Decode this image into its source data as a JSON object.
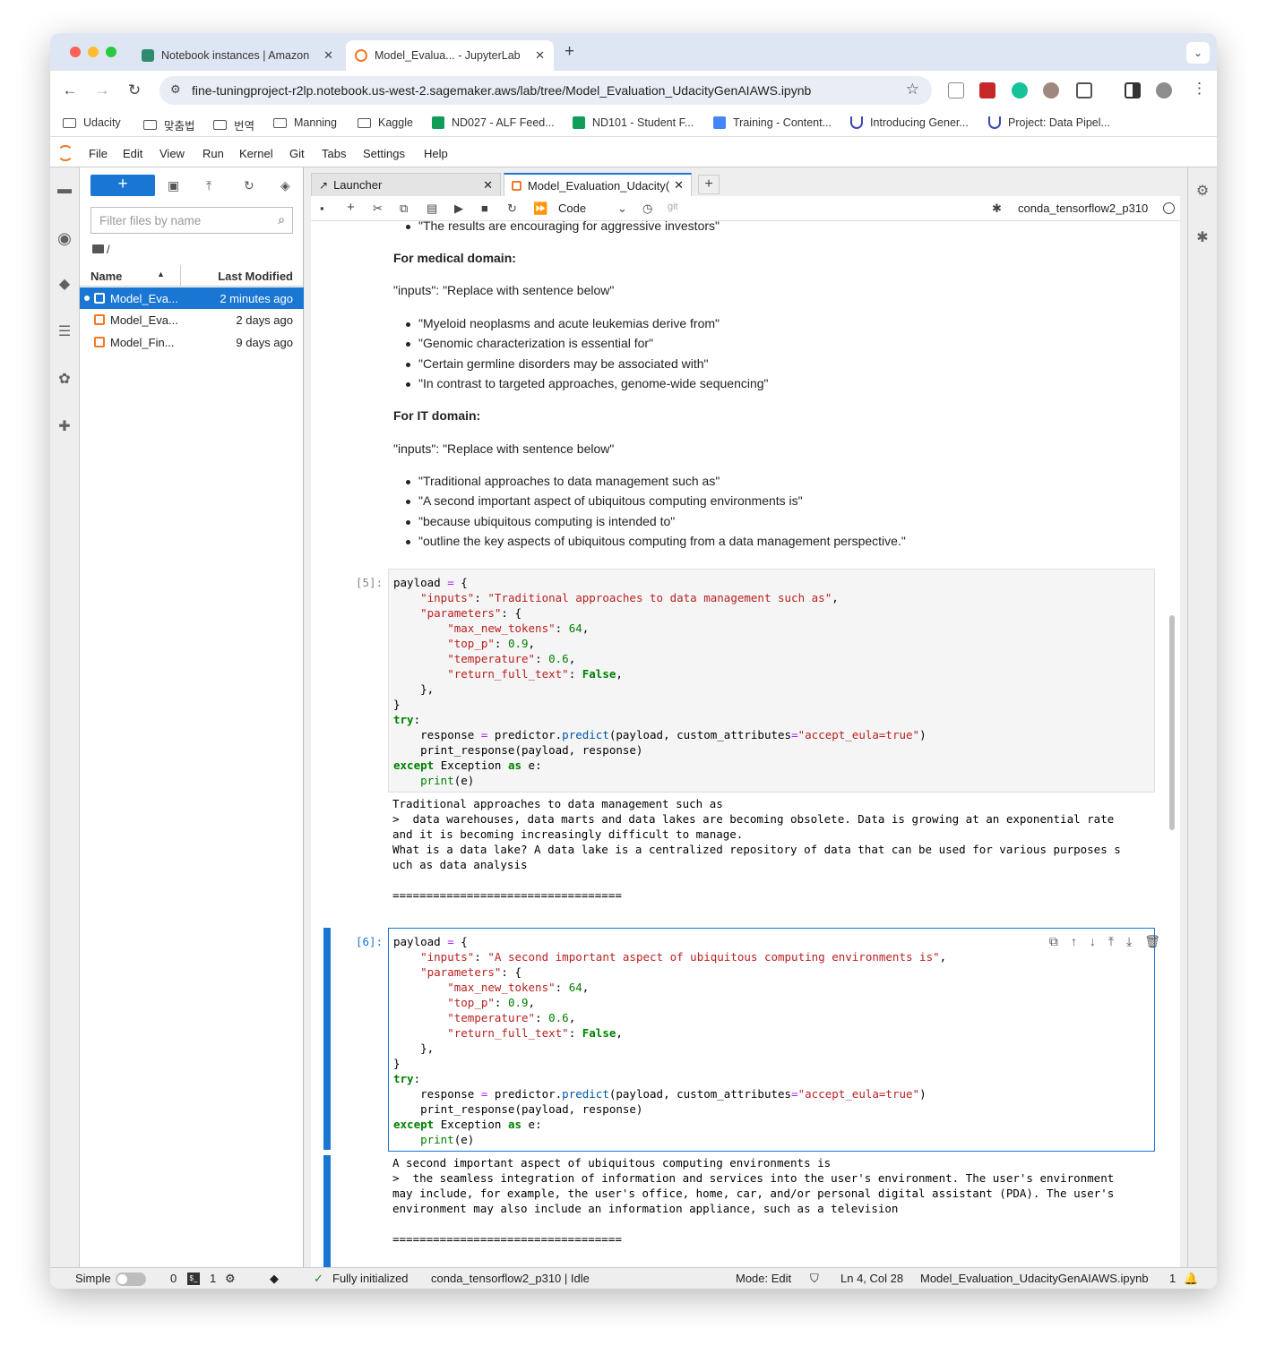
{
  "browser": {
    "tabs": [
      {
        "title": "Notebook instances | Amazon",
        "active": false
      },
      {
        "title": "Model_Evalua... - JupyterLab",
        "active": true
      }
    ],
    "new_tab": "+",
    "url": "fine-tuningproject-r2lp.notebook.us-west-2.sagemaker.aws/lab/tree/Model_Evaluation_UdacityGenAIAWS.ipynb",
    "bookmarks": [
      "Udacity",
      "맞춤법",
      "번역",
      "Manning",
      "Kaggle",
      "ND027 - ALF Feed...",
      "ND101 - Student F...",
      "Training - Content...",
      "Introducing Gener...",
      "Project: Data Pipel..."
    ]
  },
  "jupyter": {
    "menu": [
      "File",
      "Edit",
      "View",
      "Run",
      "Kernel",
      "Git",
      "Tabs",
      "Settings",
      "Help"
    ],
    "filebrowser": {
      "new_label": "+",
      "filter_placeholder": "Filter files by name",
      "breadcrumb": "/",
      "col_name": "Name",
      "col_modified": "Last Modified",
      "files": [
        {
          "name": "Model_Eva...",
          "modified": "2 minutes ago",
          "selected": true
        },
        {
          "name": "Model_Eva...",
          "modified": "2 days ago",
          "selected": false
        },
        {
          "name": "Model_Fin...",
          "modified": "9 days ago",
          "selected": false
        }
      ]
    },
    "doc_tabs": [
      {
        "title": "Launcher",
        "active": false
      },
      {
        "title": "Model_Evaluation_Udacity(",
        "active": true
      }
    ],
    "toolbar": {
      "cell_type": "Code",
      "git": "git",
      "kernel": "conda_tensorflow2_p310"
    },
    "markdown": {
      "top_bullet": "\"The results are encouraging for aggressive investors\"",
      "medical_heading": "For medical domain:",
      "medical_inputs": "\"inputs\": \"Replace with sentence below\"",
      "medical_bullets": [
        "\"Myeloid neoplasms and acute leukemias derive from\"",
        "\"Genomic characterization is essential for\"",
        "\"Certain germline disorders may be associated with\"",
        "\"In contrast to targeted approaches, genome-wide sequencing\""
      ],
      "it_heading": "For IT domain:",
      "it_inputs": "\"inputs\": \"Replace with sentence below\"",
      "it_bullets": [
        "\"Traditional approaches to data management such as\"",
        "\"A second important aspect of ubiquitous computing environments is\"",
        "\"because ubiquitous computing is intended to\"",
        "\"outline the key aspects of ubiquitous computing from a data management perspective.\""
      ]
    },
    "cells": [
      {
        "prompt": "[5]:",
        "input_text": "Traditional approaches to data management such as",
        "output": "Traditional approaches to data management such as\n>  data warehouses, data marts and data lakes are becoming obsolete. Data is growing at an exponential rate\nand it is becoming increasingly difficult to manage.\nWhat is a data lake? A data lake is a centralized repository of data that can be used for various purposes s\nuch as data analysis\n\n=================================="
      },
      {
        "prompt": "[6]:",
        "input_text": "A second important aspect of ubiquitous computing environments is",
        "output": "A second important aspect of ubiquitous computing environments is\n>  the seamless integration of information and services into the user's environment. The user's environment\nmay include, for example, the user's office, home, car, and/or personal digital assistant (PDA). The user's\nenvironment may also include an information appliance, such as a television\n\n=================================="
      }
    ],
    "code_tokens": {
      "payload": "payload",
      "eq": "=",
      "inputs_key": "\"inputs\"",
      "parameters_key": "\"parameters\"",
      "max_new_tokens_key": "\"max_new_tokens\"",
      "max_new_tokens": "64",
      "top_p_key": "\"top_p\"",
      "top_p": "0.9",
      "temperature_key": "\"temperature\"",
      "temperature": "0.6",
      "return_full_text_key": "\"return_full_text\"",
      "false": "False",
      "try": "try",
      "except": "except",
      "exception": "Exception",
      "as": "as",
      "predict": "predict",
      "eula": "\"accept_eula=true\"",
      "print": "print"
    },
    "status": {
      "mode_label": "Simple",
      "terminals": "0",
      "kernels": "1",
      "initialized": "Fully initialized",
      "kernel_status": "conda_tensorflow2_p310 | Idle",
      "mode": "Mode: Edit",
      "cursor": "Ln 4, Col 28",
      "filename": "Model_Evaluation_UdacityGenAIAWS.ipynb",
      "notifications": "1"
    }
  }
}
